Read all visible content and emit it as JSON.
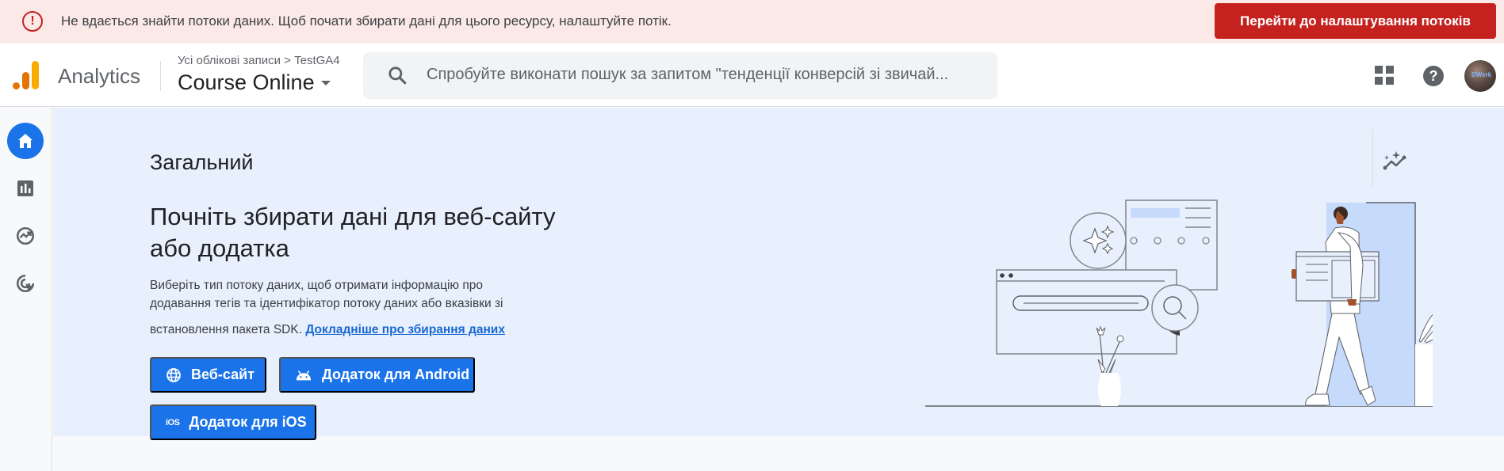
{
  "banner": {
    "icon": "error-icon",
    "message": "Не вдається знайти потоки даних. Щоб почати збирати дані для цього ресурсу, налаштуйте потік.",
    "action_label": "Перейти до налаштування потоків",
    "color": "#c5221f"
  },
  "header": {
    "app_name": "Analytics",
    "breadcrumb": "Усі облікові записи > TestGA4",
    "property_name": "Course Online",
    "search_placeholder": "Спробуйте виконати пошук за запитом \"тенденції конверсій зі звичай...",
    "icons": [
      "apps-icon",
      "help-icon",
      "avatar"
    ],
    "avatar_text": "DWerk"
  },
  "sidebar": {
    "items": [
      {
        "name": "home",
        "icon": "home-icon",
        "active": true
      },
      {
        "name": "reports",
        "icon": "bar-chart-icon",
        "active": false
      },
      {
        "name": "explore",
        "icon": "explore-icon",
        "active": false
      },
      {
        "name": "advertising",
        "icon": "target-cursor-icon",
        "active": false
      }
    ],
    "accent": "#1a73e8"
  },
  "main": {
    "page_title": "Загальний",
    "hero_title": "Почніть збирати дані для веб-сайту або додатка",
    "description_line1": "Виберіть тип потоку даних, щоб отримати інформацію про",
    "description_line2": "додавання тегів та ідентифікатор потоку даних або вказівки зі",
    "description_line3": "встановлення пакета SDK.",
    "learn_more_link": "Докладніше про збирання даних",
    "buttons": {
      "web": "Веб-сайт",
      "android": "Додаток для Android",
      "ios": "Додаток для iOS",
      "ios_icon_text": "iOS"
    },
    "button_color": "#1a73e8",
    "hero_bg": "#e8f0fe"
  }
}
